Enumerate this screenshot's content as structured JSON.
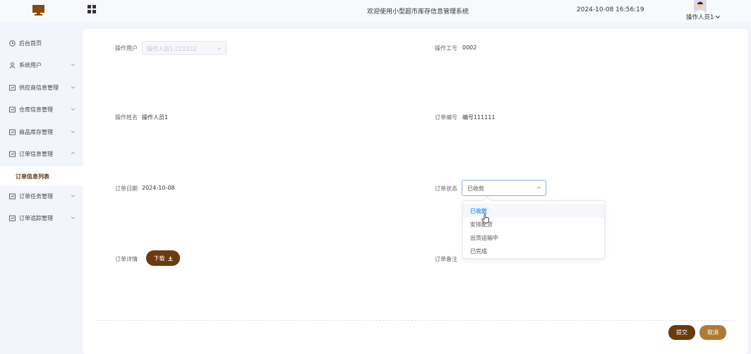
{
  "header": {
    "title": "欢迎使用小型超市库存信息管理系统",
    "datetime": "2024-10-08 16:56:19",
    "user_name": "操作人员1"
  },
  "sidebar": {
    "items": [
      {
        "label": "后台首页",
        "icon": "clock-icon"
      },
      {
        "label": "系统用户",
        "icon": "user-icon"
      },
      {
        "label": "供应商信息管理",
        "icon": "board-icon"
      },
      {
        "label": "仓库信息管理",
        "icon": "board-icon"
      },
      {
        "label": "商品库存管理",
        "icon": "board-icon"
      },
      {
        "label": "订单信息管理",
        "icon": "board-icon"
      },
      {
        "label": "订单任务管理",
        "icon": "board-icon"
      },
      {
        "label": "订单追踪管理",
        "icon": "board-icon"
      }
    ],
    "active_sub": "订单信息列表"
  },
  "form": {
    "operator_user_label": "操作用户",
    "operator_user_value": "操作人员1-222222",
    "operator_no_label": "操作工号",
    "operator_no_value": "0002",
    "operator_name_label": "操作姓名",
    "operator_name_value": "操作人员1",
    "order_no_label": "订单编号",
    "order_no_value": "编号111111",
    "order_date_label": "订单日期",
    "order_date_value": "2024-10-08",
    "order_status_label": "订单状态",
    "order_status_value": "已收款",
    "order_detail_label": "订单详情",
    "download_label": "下载",
    "order_remark_label": "订单备注"
  },
  "dropdown": {
    "options": [
      "已收款",
      "安排配货",
      "出货运输中",
      "已完成"
    ],
    "selected_index": 0
  },
  "actions": {
    "submit_label": "提交",
    "cancel_label": "取消"
  },
  "colors": {
    "primary_brown": "#6b3a0e",
    "cancel_brown": "#b07a34",
    "selected_blue": "#409eff"
  }
}
